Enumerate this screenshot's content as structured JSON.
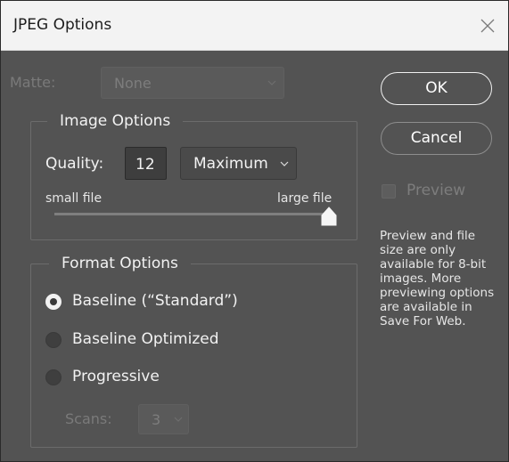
{
  "window": {
    "title": "JPEG Options"
  },
  "matte": {
    "label": "Matte:",
    "value": "None"
  },
  "image_options": {
    "title": "Image Options",
    "quality_label": "Quality:",
    "quality_value": "12",
    "quality_preset": "Maximum",
    "small_file_label": "small file",
    "large_file_label": "large file",
    "slider_level": 1.0
  },
  "format_options": {
    "title": "Format Options",
    "options": [
      {
        "label": "Baseline (“Standard”)",
        "selected": true
      },
      {
        "label": "Baseline Optimized",
        "selected": false
      },
      {
        "label": "Progressive",
        "selected": false
      }
    ],
    "scans_label": "Scans:",
    "scans_value": "3"
  },
  "buttons": {
    "ok": "OK",
    "cancel": "Cancel"
  },
  "preview": {
    "label": "Preview",
    "checked": false,
    "note": "Preview and file size are only available for 8-bit images. More previewing options are available in Save For Web."
  },
  "colors": {
    "dialog_bg": "#535353",
    "titlebar_bg": "#f3f3f3",
    "text": "#f2f2f2",
    "disabled_text": "#7d7d7d"
  },
  "icons": {
    "close": "close-icon",
    "dropdown": "chevron-down-icon",
    "slider_thumb": "slider-thumb-icon"
  }
}
